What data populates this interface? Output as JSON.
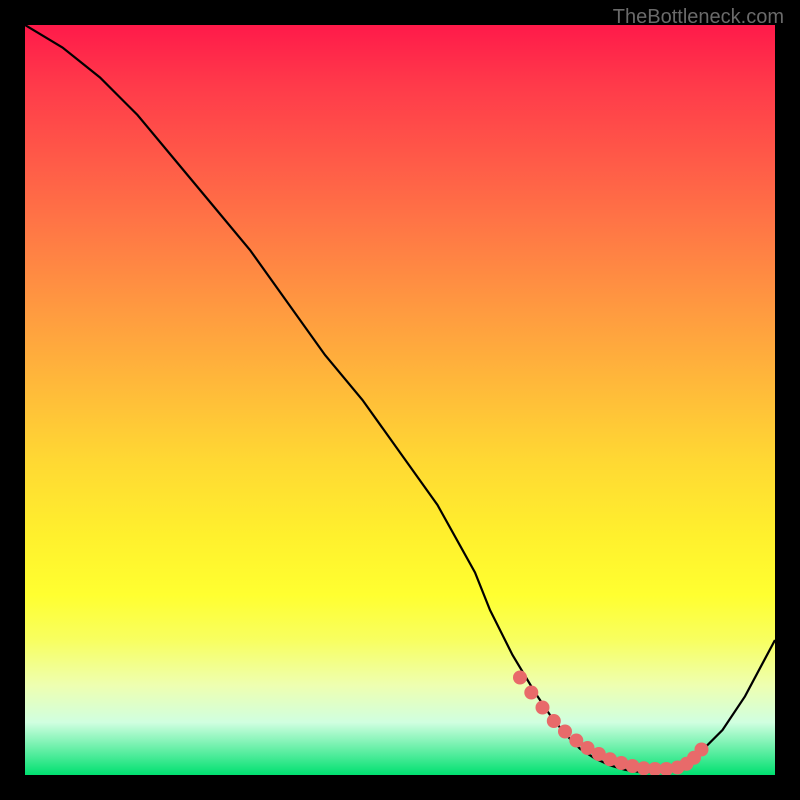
{
  "attribution": "TheBottleneck.com",
  "chart_data": {
    "type": "line",
    "title": "",
    "xlabel": "",
    "ylabel": "",
    "xlim": [
      0,
      100
    ],
    "ylim": [
      0,
      100
    ],
    "series": [
      {
        "name": "bottleneck-curve",
        "x": [
          0,
          5,
          10,
          15,
          20,
          25,
          30,
          35,
          40,
          45,
          50,
          55,
          60,
          62,
          65,
          68,
          70,
          72,
          74,
          76,
          78,
          80,
          82,
          84,
          86,
          88,
          90,
          93,
          96,
          100
        ],
        "y": [
          100,
          97,
          93,
          88,
          82,
          76,
          70,
          63,
          56,
          50,
          43,
          36,
          27,
          22,
          16,
          11,
          8,
          5.5,
          3.5,
          2.2,
          1.3,
          0.7,
          0.4,
          0.4,
          0.7,
          1.4,
          3.0,
          6.0,
          10.5,
          18
        ]
      }
    ],
    "highlight_points": {
      "name": "optimal-zone-dots",
      "x": [
        66,
        67.5,
        69,
        70.5,
        72,
        73.5,
        75,
        76.5,
        78,
        79.5,
        81,
        82.5,
        84,
        85.5,
        87,
        88.2,
        89.2,
        90.2
      ],
      "y": [
        13,
        11,
        9,
        7.2,
        5.8,
        4.6,
        3.6,
        2.8,
        2.1,
        1.6,
        1.2,
        0.9,
        0.8,
        0.8,
        1.0,
        1.5,
        2.3,
        3.4
      ]
    },
    "gradient_meaning": "background vertical gradient red(top)=high bottleneck, green(bottom)=low bottleneck"
  }
}
